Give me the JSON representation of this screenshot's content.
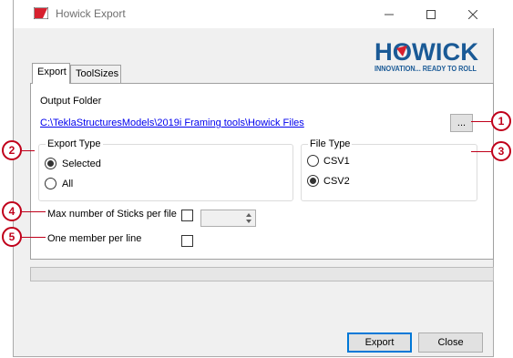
{
  "window": {
    "title": "Howick Export",
    "controls": {
      "minimize": "—",
      "maximize": "☐",
      "close": "✕"
    }
  },
  "logo": {
    "brand": "HOWICK",
    "tagline": "INNOVATION... READY TO ROLL",
    "colors": {
      "primary": "#1a5a96",
      "accent": "#d7202e"
    }
  },
  "tabs": [
    {
      "label": "Export",
      "active": true
    },
    {
      "label": "ToolSizes",
      "active": false
    }
  ],
  "export": {
    "output_folder_label": "Output Folder",
    "output_folder_path": "C:\\TeklaStructuresModels\\2019i Framing tools\\Howick Files",
    "browse_label": "...",
    "export_type": {
      "legend": "Export Type",
      "options": [
        {
          "label": "Selected",
          "checked": true
        },
        {
          "label": "All",
          "checked": false
        }
      ]
    },
    "file_type": {
      "legend": "File Type",
      "options": [
        {
          "label": "CSV1",
          "checked": false
        },
        {
          "label": "CSV2",
          "checked": true
        }
      ]
    },
    "max_sticks_label": "Max number of Sticks per file",
    "max_sticks_checked": false,
    "max_sticks_value": "",
    "one_member_label": "One member per line",
    "one_member_checked": false
  },
  "progress": {
    "value": 0
  },
  "footer": {
    "export_label": "Export",
    "close_label": "Close"
  },
  "callouts": [
    "1",
    "2",
    "3",
    "4",
    "5"
  ],
  "colors": {
    "callout": "#c0001a",
    "link": "#0000ee",
    "default_button_border": "#0078d7"
  }
}
